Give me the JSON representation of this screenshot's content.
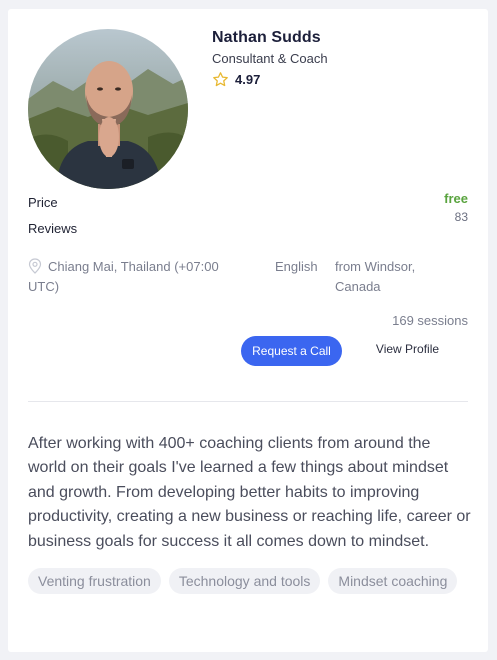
{
  "profile": {
    "name": "Nathan Sudds",
    "role": "Consultant & Coach",
    "rating": "4.97",
    "price_label": "Price",
    "price_value": "free",
    "reviews_label": "Reviews",
    "reviews_value": "83",
    "location": "Chiang Mai, Thailand (+07:00 UTC)",
    "language": "English",
    "origin": "from Windsor, Canada",
    "sessions": "169 sessions",
    "request_call_label": "Request a Call",
    "view_profile_label": "View Profile",
    "bio": "After working with 400+ coaching clients from around the world on their goals I've learned a few things about mindset and growth. From developing better habits to improving productivity, creating a new business or reaching life, career or business goals for success it all comes down to mindset.",
    "tags": [
      "Venting frustration",
      "Technology and tools",
      "Mindset coaching"
    ]
  },
  "colors": {
    "accent": "#3b66f0",
    "price_free": "#5aa43f",
    "star": "#e8b830"
  },
  "icons": {
    "rating": "star-outline-icon",
    "location": "map-pin-icon"
  }
}
